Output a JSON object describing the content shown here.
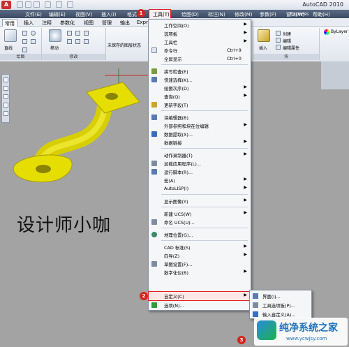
{
  "app": {
    "logo_letter": "A",
    "title": "AutoCAD 2010"
  },
  "menubar": {
    "items": [
      "文件(E)",
      "编辑(E)",
      "视图(V)",
      "插入(I)",
      "格式",
      "绘图(D)",
      "标注(N)",
      "修改(M)",
      "参数(P)",
      "窗口(W)",
      "帮助(H)",
      "Express"
    ],
    "active": "工具(T)"
  },
  "tabs": {
    "active": "常用",
    "items": [
      "插入",
      "注释",
      "参数化",
      "视图",
      "管理",
      "输出",
      "Expr"
    ]
  },
  "ribbon": {
    "draw_label": "直线",
    "move_label": "移动",
    "layer_status": "未保存的图层状态",
    "group_draw": "绘图",
    "group_modify": "修改",
    "insert_label": "插入",
    "create_label": "创建",
    "edit_label": "编辑",
    "edit_attr_label": "编辑属性",
    "group_block": "块",
    "bylayer": "ByLayer"
  },
  "caption": "设计师小咖",
  "tools_menu": {
    "items": [
      {
        "label": "工作空间(O)",
        "shortcut": "",
        "arrow": true
      },
      {
        "label": "选项板",
        "shortcut": "",
        "arrow": true
      },
      {
        "label": "工具栏",
        "shortcut": "",
        "arrow": true
      },
      {
        "label": "命令行",
        "shortcut": "Ctrl+9",
        "arrow": false
      },
      {
        "label": "全屏显示",
        "shortcut": "Ctrl+0",
        "arrow": false
      },
      {
        "label": "拼写检查(E)",
        "shortcut": "",
        "arrow": false
      },
      {
        "label": "快速选择(K)...",
        "shortcut": "",
        "arrow": false
      },
      {
        "label": "绘图次序(D)",
        "shortcut": "",
        "arrow": true
      },
      {
        "label": "查询(Q)",
        "shortcut": "",
        "arrow": true
      },
      {
        "label": "更新字段(T)",
        "shortcut": "",
        "arrow": false
      },
      {
        "label": "块编辑器(B)",
        "shortcut": "",
        "arrow": false
      },
      {
        "label": "外部参照和块在位编辑",
        "shortcut": "",
        "arrow": true
      },
      {
        "label": "数据提取(X)...",
        "shortcut": "",
        "arrow": false
      },
      {
        "label": "数据链接",
        "shortcut": "",
        "arrow": true
      },
      {
        "label": "动作录制器(T)",
        "shortcut": "",
        "arrow": true
      },
      {
        "label": "加载应用程序(L)...",
        "shortcut": "",
        "arrow": false
      },
      {
        "label": "运行脚本(R)...",
        "shortcut": "",
        "arrow": false
      },
      {
        "label": "宏(A)",
        "shortcut": "",
        "arrow": true
      },
      {
        "label": "AutoLISP(I)",
        "shortcut": "",
        "arrow": true
      },
      {
        "label": "显示图像(Y)",
        "shortcut": "",
        "arrow": true
      },
      {
        "label": "新建 UCS(W)",
        "shortcut": "",
        "arrow": true
      },
      {
        "label": "命名 UCS(U)...",
        "shortcut": "",
        "arrow": false
      },
      {
        "label": "地理位置(G)...",
        "shortcut": "",
        "arrow": false
      },
      {
        "label": "CAD 标准(S)",
        "shortcut": "",
        "arrow": true
      },
      {
        "label": "向导(Z)",
        "shortcut": "",
        "arrow": true
      },
      {
        "label": "草图设置(F)...",
        "shortcut": "",
        "arrow": false
      },
      {
        "label": "数字化仪(B)",
        "shortcut": "",
        "arrow": true
      },
      {
        "label": "自定义(C)",
        "shortcut": "",
        "arrow": true
      },
      {
        "label": "选项(N)...",
        "shortcut": "",
        "arrow": false
      }
    ]
  },
  "customize_submenu": {
    "items": [
      "界面(I)...",
      "工具选项板(P)...",
      "输入自定义(A)..."
    ]
  },
  "badges": [
    "1",
    "2",
    "3"
  ],
  "watermark": {
    "title": "纯净系统之家",
    "url": "www.ycwjsy.com"
  },
  "colors": {
    "highlight": "#e02020",
    "part": "#e8e000",
    "badge": "#d4251f"
  }
}
